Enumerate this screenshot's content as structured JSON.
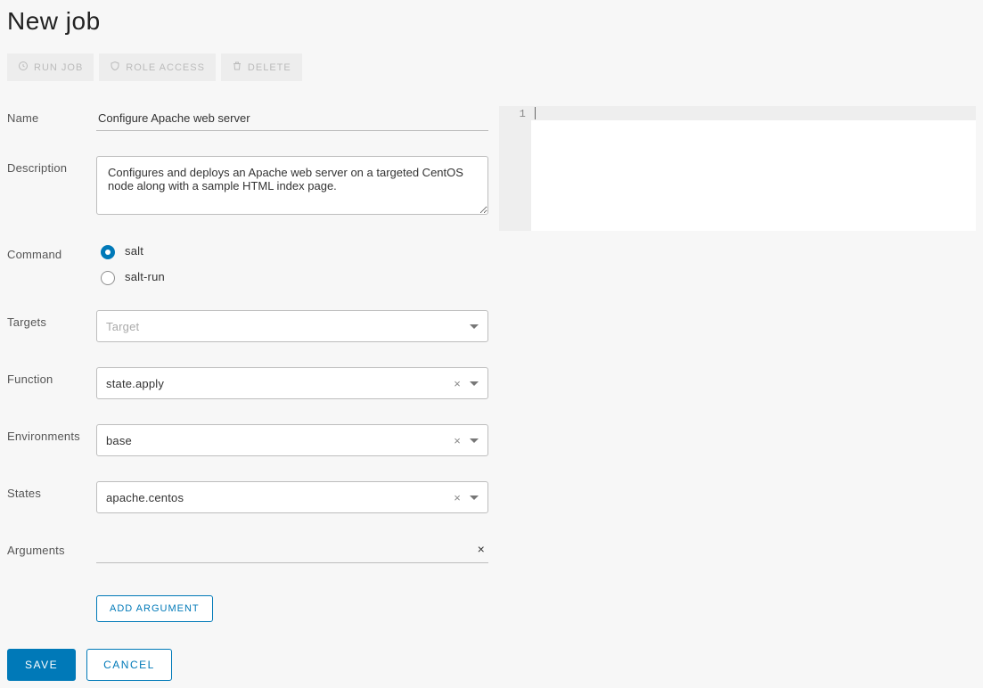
{
  "page": {
    "title": "New job"
  },
  "toolbar": {
    "run_job": "RUN JOB",
    "role_access": "ROLE ACCESS",
    "delete": "DELETE"
  },
  "form": {
    "name": {
      "label": "Name",
      "value": "Configure Apache web server"
    },
    "description": {
      "label": "Description",
      "value": "Configures and deploys an Apache web server on a targeted CentOS node along with a sample HTML index page."
    },
    "command": {
      "label": "Command",
      "options": {
        "salt": "salt",
        "salt_run": "salt-run"
      },
      "selected": "salt"
    },
    "targets": {
      "label": "Targets",
      "placeholder": "Target",
      "value": ""
    },
    "function": {
      "label": "Function",
      "value": "state.apply"
    },
    "environments": {
      "label": "Environments",
      "value": "base"
    },
    "states": {
      "label": "States",
      "value": "apache.centos"
    },
    "arguments": {
      "label": "Arguments",
      "items": [
        ""
      ]
    },
    "add_argument": "ADD ARGUMENT"
  },
  "editor": {
    "line_numbers": [
      "1"
    ]
  },
  "actions": {
    "save": "SAVE",
    "cancel": "CANCEL"
  }
}
